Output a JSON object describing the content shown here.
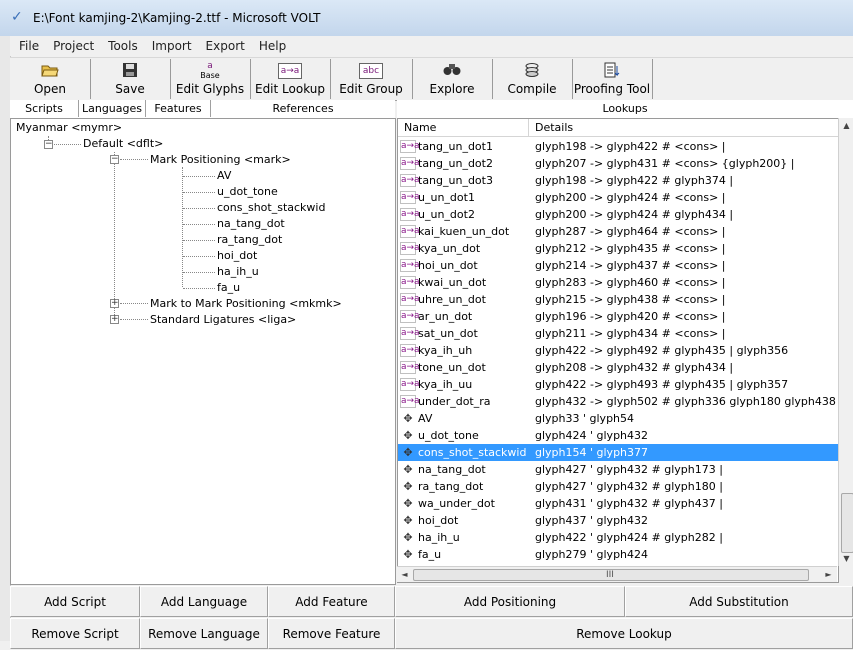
{
  "window": {
    "title": "E:\\Font kamjing-2\\Kamjing-2.ttf - Microsoft VOLT"
  },
  "menu": [
    "File",
    "Project",
    "Tools",
    "Import",
    "Export",
    "Help"
  ],
  "toolbar": {
    "open": "Open",
    "save": "Save",
    "edit_glyphs": "Edit Glyphs",
    "edit_glyphs_icon_top": "a",
    "edit_glyphs_icon_bottom": "Base",
    "edit_lookup": "Edit Lookup",
    "edit_lookup_icon": "a→a",
    "edit_group": "Edit Group",
    "edit_group_icon": "abc",
    "explore": "Explore",
    "compile": "Compile",
    "proofing_tool": "Proofing Tool"
  },
  "left_headers": [
    "Scripts",
    "Languages",
    "Features",
    "References"
  ],
  "right_header": "Lookups",
  "tree": {
    "script": "Myanmar <mymr>",
    "language": "Default <dflt>",
    "feature_mark": "Mark Positioning <mark>",
    "mark_lookups": [
      "AV",
      "u_dot_tone",
      "cons_shot_stackwid",
      "na_tang_dot",
      "ra_tang_dot",
      "hoi_dot",
      "ha_ih_u",
      "fa_u"
    ],
    "feature_mkmk": "Mark to Mark Positioning <mkmk>",
    "feature_liga": "Standard Ligatures <liga>"
  },
  "lookups": {
    "col_name": "Name",
    "col_details": "Details",
    "sub_icon": "a→a",
    "pos_icon": "✥",
    "rows": [
      {
        "type": "sub",
        "name": "tang_un_dot1",
        "details": "glyph198 -> glyph422  # <cons>  |"
      },
      {
        "type": "sub",
        "name": "tang_un_dot2",
        "details": "glyph207 -> glyph431  # <cons>  {glyph200} |"
      },
      {
        "type": "sub",
        "name": "tang_un_dot3",
        "details": "glyph198 -> glyph422  # glyph374 |"
      },
      {
        "type": "sub",
        "name": "u_un_dot1",
        "details": "glyph200 -> glyph424  # <cons>  |"
      },
      {
        "type": "sub",
        "name": "u_un_dot2",
        "details": "glyph200 -> glyph424  # glyph434 |"
      },
      {
        "type": "sub",
        "name": "kai_kuen_un_dot",
        "details": "glyph287 -> glyph464  # <cons>  |"
      },
      {
        "type": "sub",
        "name": "kya_un_dot",
        "details": "glyph212 -> glyph435  # <cons>  |"
      },
      {
        "type": "sub",
        "name": "hoi_un_dot",
        "details": "glyph214 -> glyph437  # <cons>  |"
      },
      {
        "type": "sub",
        "name": "kwai_un_dot",
        "details": "glyph283 -> glyph460  # <cons>  |"
      },
      {
        "type": "sub",
        "name": "uhre_un_dot",
        "details": "glyph215 -> glyph438  # <cons>  |"
      },
      {
        "type": "sub",
        "name": "ar_un_dot",
        "details": "glyph196 -> glyph420  # <cons>  |"
      },
      {
        "type": "sub",
        "name": "sat_un_dot",
        "details": "glyph211 -> glyph434  # <cons>  |"
      },
      {
        "type": "sub",
        "name": "kya_ih_uh",
        "details": "glyph422 -> glyph492  # glyph435 | glyph356"
      },
      {
        "type": "sub",
        "name": "tone_un_dot",
        "details": "glyph208 -> glyph432  # glyph434 |"
      },
      {
        "type": "sub",
        "name": "kya_ih_uu",
        "details": "glyph422 -> glyph493  # glyph435 | glyph357"
      },
      {
        "type": "sub",
        "name": "under_dot_ra",
        "details": "glyph432 -> glyph502  # glyph336 glyph180 glyph438 |"
      },
      {
        "type": "pos",
        "name": "AV",
        "details": "glyph33 ' glyph54"
      },
      {
        "type": "pos",
        "name": "u_dot_tone",
        "details": "glyph424 ' glyph432"
      },
      {
        "type": "pos",
        "name": "cons_shot_stackwid",
        "details": "glyph154 ' glyph377",
        "selected": true
      },
      {
        "type": "pos",
        "name": "na_tang_dot",
        "details": "glyph427 ' glyph432  # glyph173 |"
      },
      {
        "type": "pos",
        "name": "ra_tang_dot",
        "details": "glyph427 ' glyph432  # glyph180 |"
      },
      {
        "type": "pos",
        "name": "wa_under_dot",
        "details": "glyph431 ' glyph432  # glyph437 |"
      },
      {
        "type": "pos",
        "name": "hoi_dot",
        "details": "glyph437 ' glyph432"
      },
      {
        "type": "pos",
        "name": "ha_ih_u",
        "details": "glyph422 ' glyph424  # glyph282 |"
      },
      {
        "type": "pos",
        "name": "fa_u",
        "details": "glyph279 ' glyph424"
      }
    ]
  },
  "buttons": {
    "add_script": "Add Script",
    "add_language": "Add Language",
    "add_feature": "Add Feature",
    "add_positioning": "Add Positioning",
    "add_substitution": "Add Substitution",
    "remove_script": "Remove Script",
    "remove_language": "Remove Language",
    "remove_feature": "Remove Feature",
    "remove_lookup": "Remove Lookup"
  },
  "scroll": {
    "grip": "III",
    "up": "▲",
    "down": "▼",
    "left": "◄",
    "right": "►"
  }
}
